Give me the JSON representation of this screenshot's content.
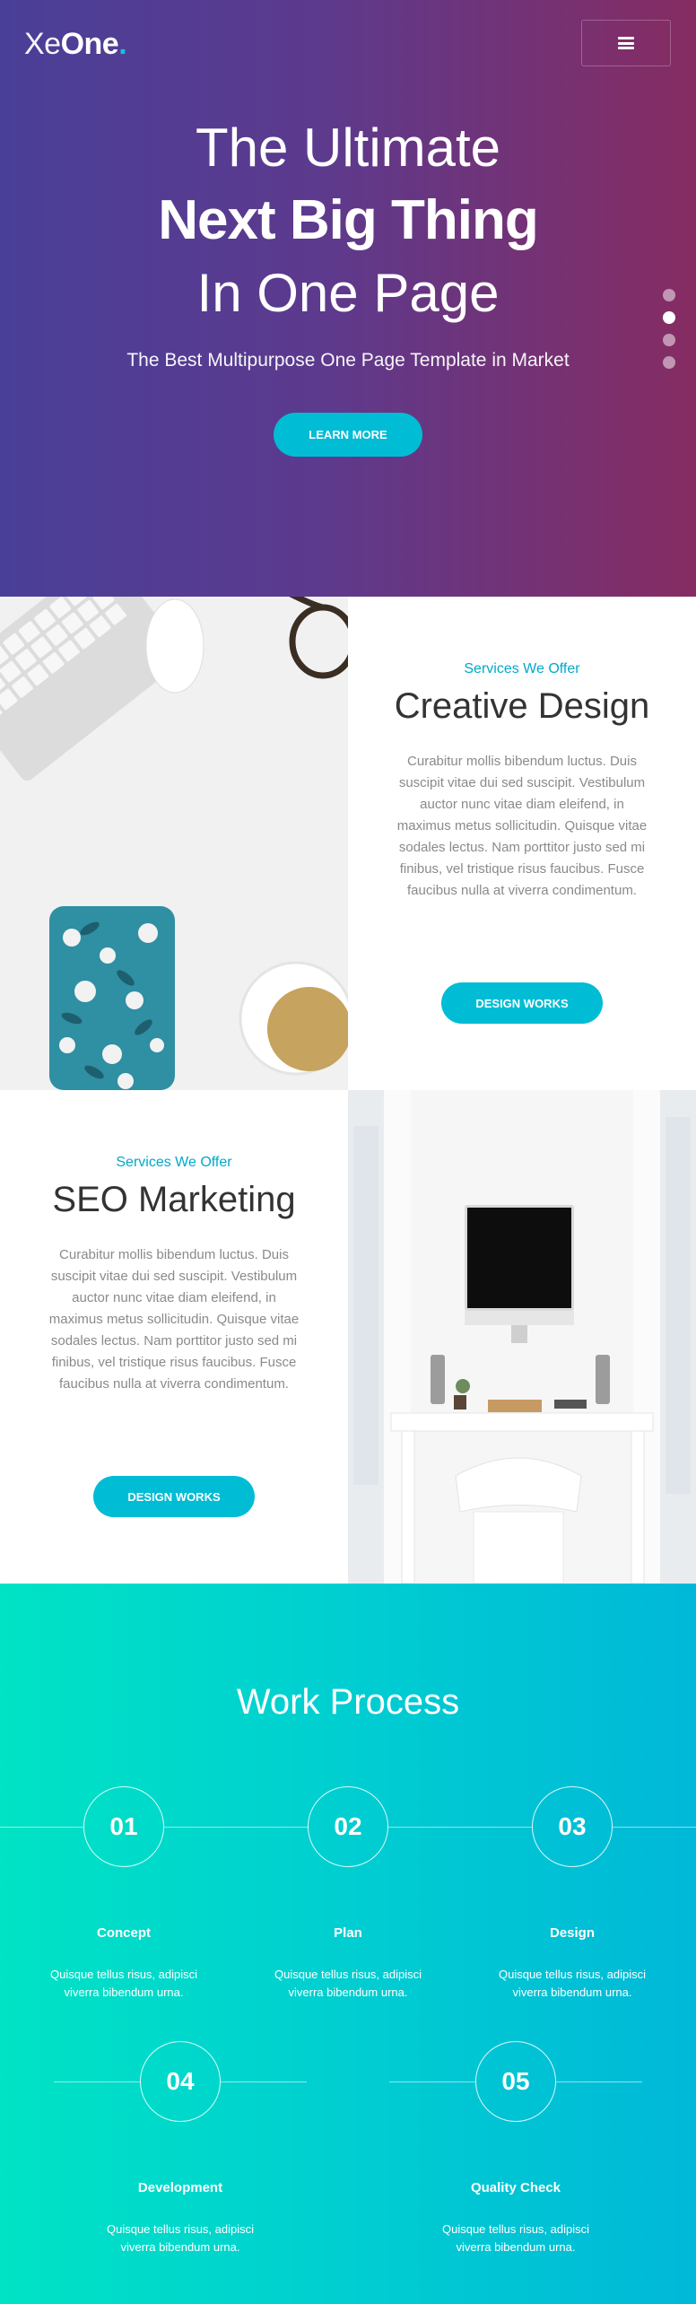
{
  "header": {
    "logo_thin": "Xe",
    "logo_bold": "One",
    "logo_dot": ".",
    "menu_icon": "hamburger-icon"
  },
  "hero": {
    "line1": "The Ultimate",
    "line2": "Next Big Thing",
    "line3": "In One Page",
    "subtitle": "The Best Multipurpose One Page Template in Market",
    "button": "LEARN MORE",
    "slide_dots": 4,
    "active_slide": 2
  },
  "services": [
    {
      "kicker": "Services We Offer",
      "title": "Creative Design",
      "body": "Curabitur mollis bibendum luctus. Duis suscipit vitae dui sed suscipit. Vestibulum auctor nunc vitae diam eleifend, in maximus metus sollicitudin. Quisque vitae sodales lectus. Nam porttitor justo sed mi finibus, vel tristique risus faucibus. Fusce faucibus nulla at viverra condimentum.",
      "button": "DESIGN WORKS",
      "image": "desk-flatlay-photo"
    },
    {
      "kicker": "Services We Offer",
      "title": "SEO Marketing",
      "body": "Curabitur mollis bibendum luctus. Duis suscipit vitae dui sed suscipit. Vestibulum auctor nunc vitae diam eleifend, in maximus metus sollicitudin. Quisque vitae sodales lectus. Nam porttitor justo sed mi finibus, vel tristique risus faucibus. Fusce faucibus nulla at viverra condimentum.",
      "button": "DESIGN WORKS",
      "image": "workspace-computer-photo"
    }
  ],
  "process": {
    "title": "Work Process",
    "steps": [
      {
        "num": "01",
        "name": "Concept",
        "desc": "Quisque tellus risus, adipisci viverra bibendum urna."
      },
      {
        "num": "02",
        "name": "Plan",
        "desc": "Quisque tellus risus, adipisci viverra bibendum urna."
      },
      {
        "num": "03",
        "name": "Design",
        "desc": "Quisque tellus risus, adipisci viverra bibendum urna."
      },
      {
        "num": "04",
        "name": "Development",
        "desc": "Quisque tellus risus, adipisci viverra bibendum urna."
      },
      {
        "num": "05",
        "name": "Quality Check",
        "desc": "Quisque tellus risus, adipisci viverra bibendum urna."
      }
    ]
  },
  "colors": {
    "accent": "#00bcd4",
    "hero_gradient_start": "#4a3f98",
    "hero_gradient_end": "#862c62",
    "process_gradient_start": "#00e3c4",
    "process_gradient_end": "#00b8d8"
  }
}
